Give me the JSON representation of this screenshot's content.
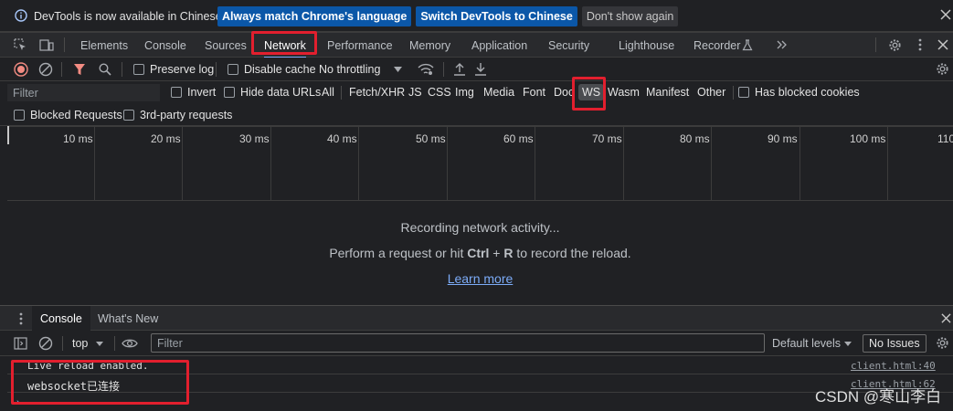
{
  "infobar": {
    "message": "DevTools is now available in Chinese!",
    "btn_match": "Always match Chrome's language",
    "btn_switch": "Switch DevTools to Chinese",
    "btn_dismiss": "Don't show again"
  },
  "tabs": [
    "Elements",
    "Console",
    "Sources",
    "Network",
    "Performance",
    "Memory",
    "Application",
    "Security",
    "Lighthouse",
    "Recorder"
  ],
  "toolbar": {
    "preserve_log": "Preserve log",
    "disable_cache": "Disable cache",
    "throttling": "No throttling"
  },
  "filter": {
    "placeholder": "Filter",
    "invert": "Invert",
    "hide_data_urls": "Hide data URLs",
    "types": [
      "All",
      "Fetch/XHR",
      "JS",
      "CSS",
      "Img",
      "Media",
      "Font",
      "Doc",
      "WS",
      "Wasm",
      "Manifest",
      "Other"
    ],
    "has_blocked_cookies": "Has blocked cookies",
    "blocked_requests": "Blocked Requests",
    "third_party": "3rd-party requests"
  },
  "timeline": {
    "ticks": [
      "10 ms",
      "20 ms",
      "30 ms",
      "40 ms",
      "50 ms",
      "60 ms",
      "70 ms",
      "80 ms",
      "90 ms",
      "100 ms",
      "110"
    ]
  },
  "empty": {
    "line1": "Recording network activity...",
    "line2_pre": "Perform a request or hit ",
    "key_ctrl": "Ctrl",
    "plus": " + ",
    "key_r": "R",
    "line2_post": " to record the reload.",
    "learn_more": "Learn more"
  },
  "drawer": {
    "tab_console": "Console",
    "tab_whats_new": "What's New",
    "context": "top",
    "filter_placeholder": "Filter",
    "levels": "Default levels",
    "no_issues": "No Issues"
  },
  "messages": [
    {
      "text": "Live reload enabled.",
      "source": "client.html:40"
    },
    {
      "text": "websocket已连接",
      "source": "client.html:62"
    }
  ],
  "watermark": "CSDN @寒山李白"
}
